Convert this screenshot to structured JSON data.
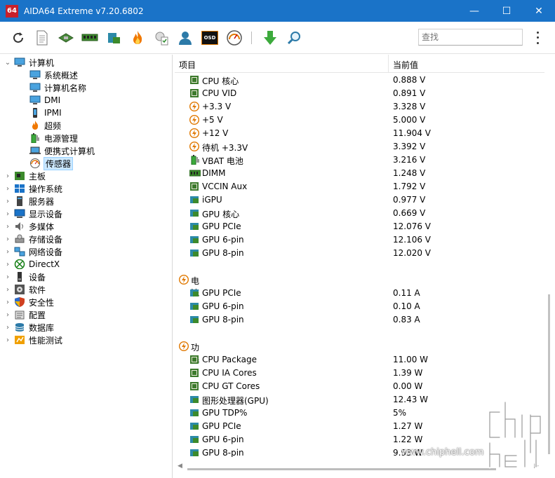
{
  "window": {
    "app_icon_text": "64",
    "title": "AIDA64 Extreme v7.20.6802",
    "minimize": "—",
    "maximize": "☐",
    "close": "✕"
  },
  "toolbar": {
    "search_placeholder": "查找",
    "osd_label": "OSD"
  },
  "tree": {
    "root": {
      "label": "计算机",
      "expanded": true
    },
    "children": [
      {
        "label": "系统概述",
        "icon": "monitor-icon"
      },
      {
        "label": "计算机名称",
        "icon": "monitor-icon"
      },
      {
        "label": "DMI",
        "icon": "monitor-icon"
      },
      {
        "label": "IPMI",
        "icon": "phone-icon"
      },
      {
        "label": "超频",
        "icon": "flame-icon"
      },
      {
        "label": "电源管理",
        "icon": "battery-icon"
      },
      {
        "label": "便携式计算机",
        "icon": "laptop-icon"
      },
      {
        "label": "传感器",
        "icon": "gauge-icon",
        "selected": true
      }
    ],
    "top_items": [
      {
        "label": "主板",
        "icon": "motherboard-icon"
      },
      {
        "label": "操作系统",
        "icon": "windows-icon"
      },
      {
        "label": "服务器",
        "icon": "server-icon"
      },
      {
        "label": "显示设备",
        "icon": "display-icon"
      },
      {
        "label": "多媒体",
        "icon": "speaker-icon"
      },
      {
        "label": "存储设备",
        "icon": "storage-icon"
      },
      {
        "label": "网络设备",
        "icon": "network-icon"
      },
      {
        "label": "DirectX",
        "icon": "xbox-icon"
      },
      {
        "label": "设备",
        "icon": "device-icon"
      },
      {
        "label": "软件",
        "icon": "software-icon"
      },
      {
        "label": "安全性",
        "icon": "shield-icon"
      },
      {
        "label": "配置",
        "icon": "config-icon"
      },
      {
        "label": "数据库",
        "icon": "database-icon"
      },
      {
        "label": "性能测试",
        "icon": "benchmark-icon"
      }
    ]
  },
  "list": {
    "col_item": "项目",
    "col_value": "当前值",
    "voltage_rows": [
      {
        "name": "CPU 核心",
        "value": "0.888 V",
        "icon": "chip-icon"
      },
      {
        "name": "CPU VID",
        "value": "0.891 V",
        "icon": "chip-icon"
      },
      {
        "name": "+3.3 V",
        "value": "3.328 V",
        "icon": "power-icon"
      },
      {
        "name": "+5 V",
        "value": "5.000 V",
        "icon": "power-icon"
      },
      {
        "name": "+12 V",
        "value": "11.904 V",
        "icon": "power-icon"
      },
      {
        "name": "待机 +3.3V",
        "value": "3.392 V",
        "icon": "power-icon"
      },
      {
        "name": "VBAT 电池",
        "value": "3.216 V",
        "icon": "battery-icon"
      },
      {
        "name": "DIMM",
        "value": "1.248 V",
        "icon": "ram-icon"
      },
      {
        "name": "VCCIN Aux",
        "value": "1.792 V",
        "icon": "chip-icon"
      },
      {
        "name": "iGPU",
        "value": "0.977 V",
        "icon": "gpu-icon"
      },
      {
        "name": "GPU 核心",
        "value": "0.669 V",
        "icon": "gpu-icon"
      },
      {
        "name": "GPU PCIe",
        "value": "12.076 V",
        "icon": "gpu-icon"
      },
      {
        "name": "GPU 6-pin",
        "value": "12.106 V",
        "icon": "gpu-icon"
      },
      {
        "name": "GPU 8-pin",
        "value": "12.020 V",
        "icon": "gpu-icon"
      }
    ],
    "current_group": "电流",
    "current_rows": [
      {
        "name": "GPU PCIe",
        "value": "0.11 A",
        "icon": "gpu-icon"
      },
      {
        "name": "GPU 6-pin",
        "value": "0.10 A",
        "icon": "gpu-icon"
      },
      {
        "name": "GPU 8-pin",
        "value": "0.83 A",
        "icon": "gpu-icon"
      }
    ],
    "power_group": "功耗",
    "power_rows": [
      {
        "name": "CPU Package",
        "value": "11.00 W",
        "icon": "chip-icon"
      },
      {
        "name": "CPU IA Cores",
        "value": "1.39 W",
        "icon": "chip-icon"
      },
      {
        "name": "CPU GT Cores",
        "value": "0.00 W",
        "icon": "chip-icon"
      },
      {
        "name": "图形处理器(GPU)",
        "value": "12.43 W",
        "icon": "gpu-icon"
      },
      {
        "name": "GPU TDP%",
        "value": "5%",
        "icon": "gpu-icon"
      },
      {
        "name": "GPU PCIe",
        "value": "1.27 W",
        "icon": "gpu-icon"
      },
      {
        "name": "GPU 6-pin",
        "value": "1.22 W",
        "icon": "gpu-icon"
      },
      {
        "name": "GPU 8-pin",
        "value": "9.93 W",
        "icon": "gpu-icon"
      }
    ]
  },
  "watermark": {
    "url": "www.chiphell.com",
    "logo_text": "chip hell"
  },
  "colors": {
    "titlebar": "#1a73c8",
    "selection": "#cce8ff",
    "power_orange": "#f08c00",
    "chip_green": "#3c7a2c",
    "gpu_teal": "#2c8aa8"
  }
}
